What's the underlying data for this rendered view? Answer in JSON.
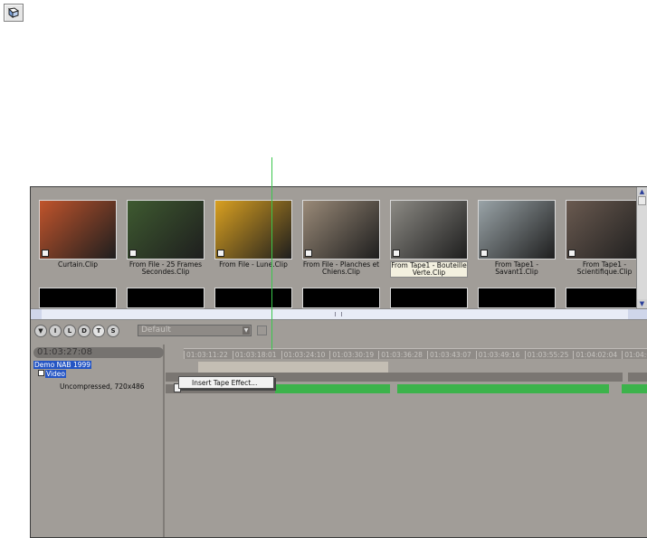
{
  "corner_icon": "book-icon",
  "bin": {
    "clips": [
      {
        "label": "Curtain.Clip",
        "color": "#c0542c",
        "selected": false
      },
      {
        "label": "From File - 25 Frames Secondes.Clip",
        "color": "#3e5a30",
        "selected": false
      },
      {
        "label": "From File - Lune.Clip",
        "color": "#d9a020",
        "selected": false
      },
      {
        "label": "From File - Planches et Chiens.Clip",
        "color": "#9a8a78",
        "selected": false
      },
      {
        "label": "From Tape1 - Bouteille Verte.Clip",
        "color": "#8c8a84",
        "selected": true
      },
      {
        "label": "From Tape1 - Savant1.Clip",
        "color": "#9aa4a8",
        "selected": false
      },
      {
        "label": "From Tape1 - Scientifique.Clip",
        "color": "#6a5a50",
        "selected": false
      }
    ],
    "second_row_count": 7
  },
  "toolbar": {
    "buttons": [
      "I",
      "L",
      "D",
      "T",
      "S"
    ],
    "preset": "Default"
  },
  "timeline": {
    "timecode": "01:03:27:08",
    "sequence": "Demo NAB 1999",
    "track": "Video",
    "format": "Uncompressed, 720x486",
    "ruler": [
      "01:03:11:22",
      "01:03:18:01",
      "01:03:24:10",
      "01:03:30:19",
      "01:03:36:28",
      "01:03:43:07",
      "01:03:49:16",
      "01:03:55:25",
      "01:04:02:04",
      "01:04:08"
    ]
  },
  "context_menu": {
    "item": "Insert Tape Effect..."
  }
}
